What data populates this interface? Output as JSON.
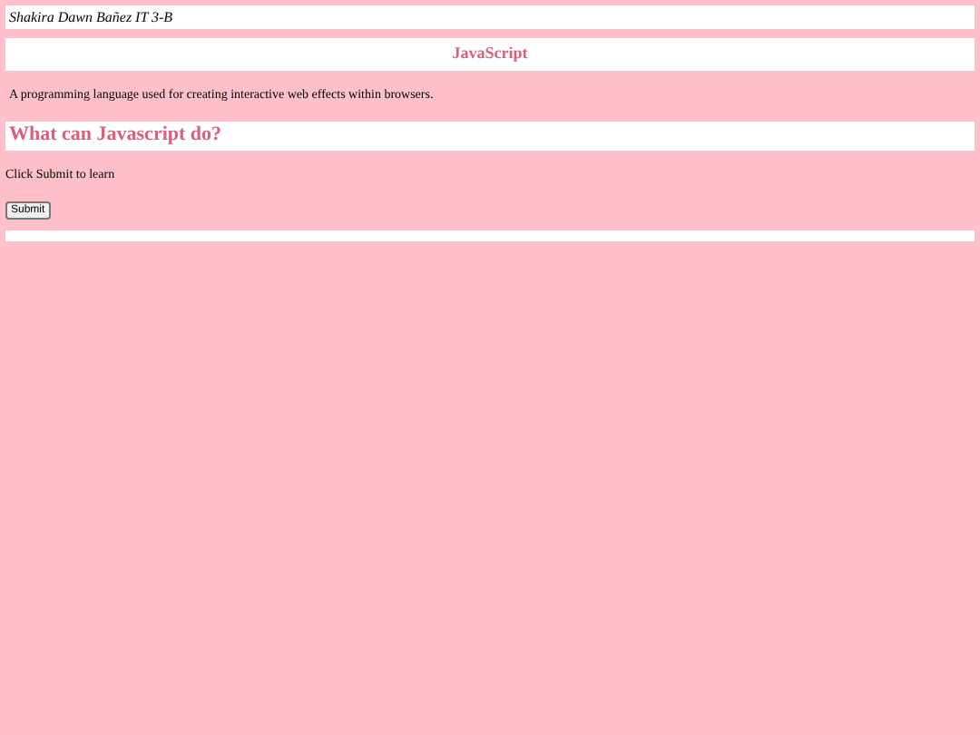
{
  "author": "Shakira Dawn Bañez IT 3-B",
  "title": "JavaScript",
  "description": "A programming language used for creating interactive web effects within browsers.",
  "question": "What can Javascript do?",
  "prompt": "Click Submit to learn",
  "submit_button": "Submit"
}
